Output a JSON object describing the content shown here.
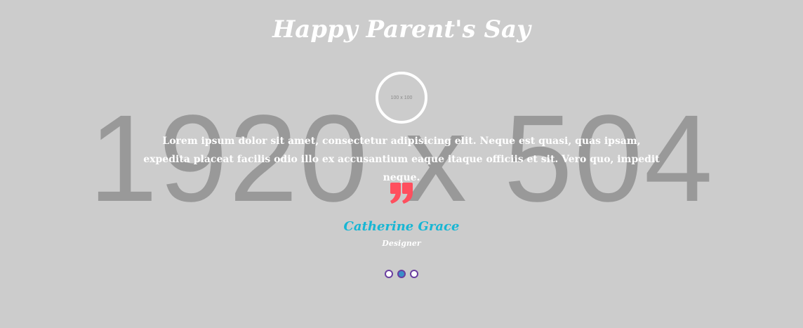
{
  "background_placeholder": "1920 x 504",
  "section": {
    "title": "Happy Parent's Say"
  },
  "testimonial": {
    "avatar_placeholder": "100 x 100",
    "text": "Lorem ipsum dolor sit amet, consectetur adipisicing elit. Neque est quasi, quas ipsam, expedita placeat facilis odio illo ex accusantium eaque itaque officiis et sit. Vero quo, impedit neque.",
    "quote_icon": "quote-right-icon",
    "name": "Catherine Grace",
    "role": "Designer"
  },
  "pagination": {
    "count": 3,
    "active_index": 1
  },
  "colors": {
    "background": "#cccccc",
    "quote_mark": "#ff4f5e",
    "name": "#17b6d4",
    "dot_border": "#6a3fa0",
    "dot_active": "#3a8fc8"
  }
}
